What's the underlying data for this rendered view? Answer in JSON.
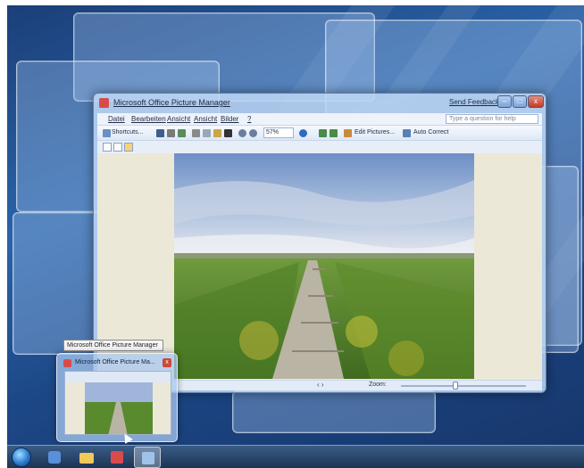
{
  "window": {
    "title": "Microsoft Office Picture Manager",
    "send_feedback": "Send Feedback",
    "help_placeholder": "Type a question for help",
    "buttons": {
      "minimize": "–",
      "maximize": "□",
      "close": "x"
    }
  },
  "menu": {
    "items": [
      "Datei",
      "Bearbeiten",
      "Ansicht",
      "Ansicht",
      "Bilder",
      "?"
    ]
  },
  "toolbar": {
    "shortcuts_label": "Shortcuts...",
    "zoom_value": "57%",
    "edit_pictures_label": "Edit Pictures...",
    "auto_correct_label": "Auto Correct"
  },
  "statusbar": {
    "zoom_label": "Zoom:",
    "nav": "‹ ›"
  },
  "taskbar": {
    "tooltip": "Microsoft Office Picture Manager",
    "preview_title": "Microsoft Office Picture Ma..."
  },
  "colors": {
    "desktop": "#2a63a8",
    "taskbar": "#1c3454",
    "canvas": "#ece8d8"
  },
  "icons": [
    "start-orb-icon",
    "ie-icon",
    "folder-icon",
    "picture-manager-icon",
    "window-icon"
  ]
}
